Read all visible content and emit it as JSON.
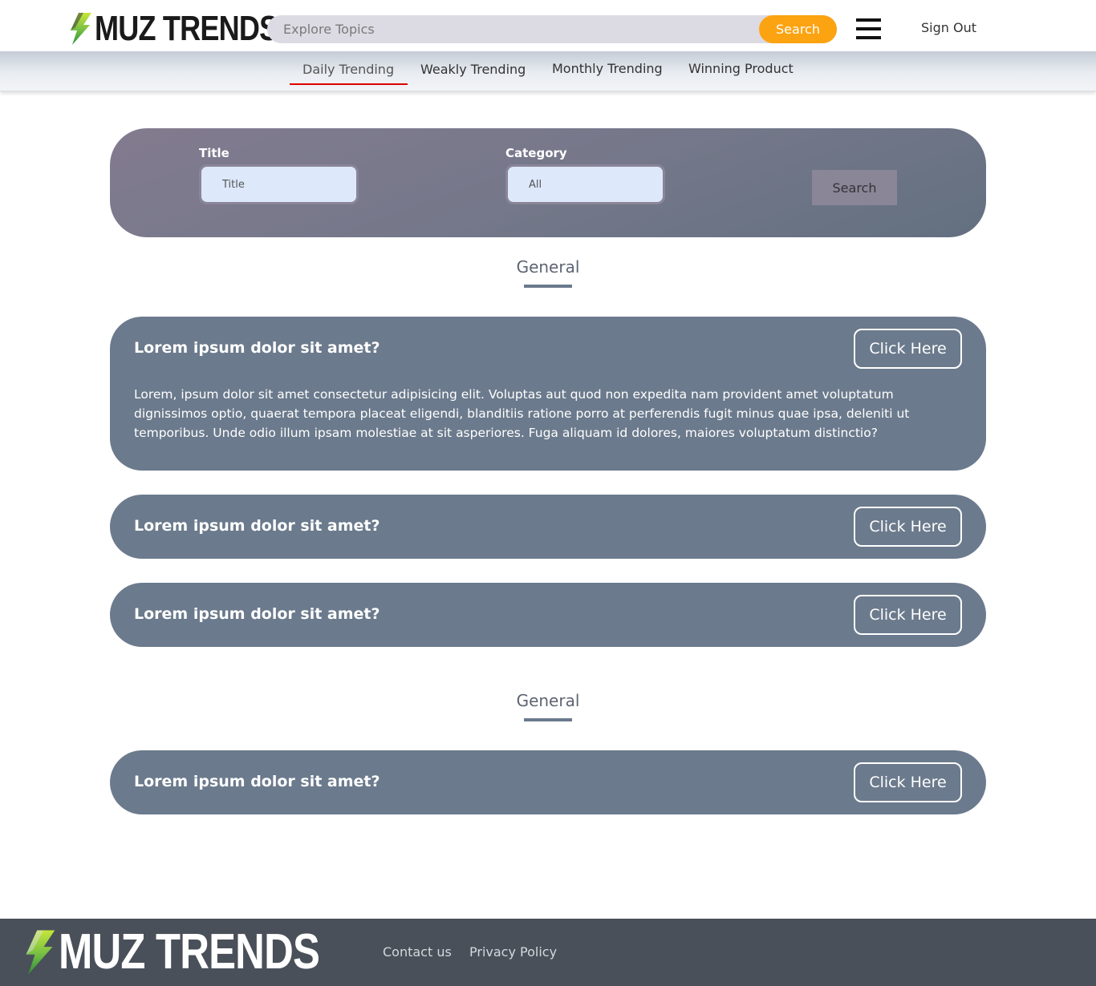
{
  "header": {
    "logo_text": "MUZ TRENDS",
    "search_placeholder": "Explore Topics",
    "search_button": "Search",
    "signout": "Sign Out"
  },
  "nav": {
    "items": [
      {
        "label": "Daily Trending"
      },
      {
        "label": "Weakly Trending"
      },
      {
        "label": "Monthly Trending"
      },
      {
        "label": "Winning Product"
      }
    ],
    "active": "Daily Trending"
  },
  "filter": {
    "title_label": "Title",
    "title_placeholder": "Title",
    "category_label": "Category",
    "category_value": "All",
    "search_button": "Search"
  },
  "sections": [
    {
      "title": "General",
      "cards": [
        {
          "title": "Lorem ipsum dolor sit amet?",
          "button": "Click Here",
          "body": "Lorem, ipsum dolor sit amet consectetur adipisicing elit. Voluptas aut quod non expedita nam provident amet voluptatum dignissimos optio, quaerat tempora placeat eligendi, blanditiis ratione porro at perferendis fugit minus quae ipsa, deleniti ut temporibus. Unde odio illum ipsam molestiae at sit asperiores. Fuga aliquam id dolores, maiores voluptatum distinctio?"
        },
        {
          "title": "Lorem ipsum dolor sit amet?",
          "button": "Click Here"
        },
        {
          "title": "Lorem ipsum dolor sit amet?",
          "button": "Click Here"
        }
      ]
    },
    {
      "title": "General",
      "cards": [
        {
          "title": "Lorem ipsum dolor sit amet?",
          "button": "Click Here"
        }
      ]
    }
  ],
  "footer": {
    "logo_text": "MUZ TRENDS",
    "links": [
      "Contact us",
      "Privacy Policy"
    ]
  },
  "colors": {
    "accent": "#fca311",
    "card_bg": "#6b7a8c",
    "footer_bg": "#4a5059",
    "active_underline": "#dd0000"
  },
  "icons": [
    "lightning-bolt-logo-icon",
    "hamburger-menu-icon"
  ]
}
